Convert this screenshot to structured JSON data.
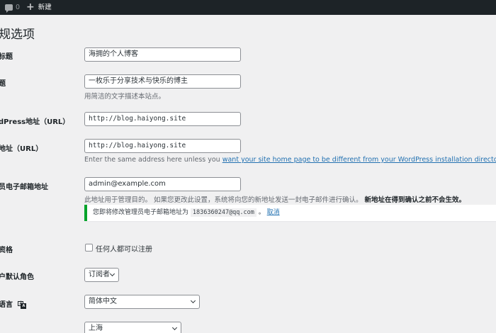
{
  "adminbar": {
    "comment_count": "0",
    "new_label": "新建"
  },
  "page": {
    "title": "规选项"
  },
  "fields": {
    "site_title": {
      "label": "标题",
      "value": "海拥的个人博客"
    },
    "tagline": {
      "label": "题",
      "value": "一枚乐于分享技术与快乐的博主",
      "desc": "用简洁的文字描述本站点。"
    },
    "wp_address": {
      "label": "dPress地址（URL）",
      "value": "http://blog.haiyong.site"
    },
    "site_address": {
      "label": "地址（URL）",
      "value": "http://blog.haiyong.site",
      "desc_prefix": "Enter the same address here unless you ",
      "desc_link": "want your site home page to be different from your WordPress installation directory",
      "desc_suffix": "."
    },
    "admin_email": {
      "label": "员电子邮箱地址",
      "value": "admin@example.com",
      "desc": "此地址用于管理目的。 如果您更改此设置，系统将向您的新地址发送一封电子邮件进行确认。 ",
      "desc_bold": "新地址在得到确认之前不会生效。"
    },
    "notice": {
      "prefix": "您即将修改管理员电子邮箱地址为",
      "email": "1836360247@qq.com",
      "separator": "。",
      "cancel": "取消"
    },
    "membership": {
      "label": "资格",
      "checkbox_label": "任何人都可以注册"
    },
    "default_role": {
      "label": "户默认角色",
      "selected": "订阅者"
    },
    "language": {
      "label": "语言",
      "selected": "简体中文"
    },
    "timezone": {
      "selected": "上海"
    }
  }
}
